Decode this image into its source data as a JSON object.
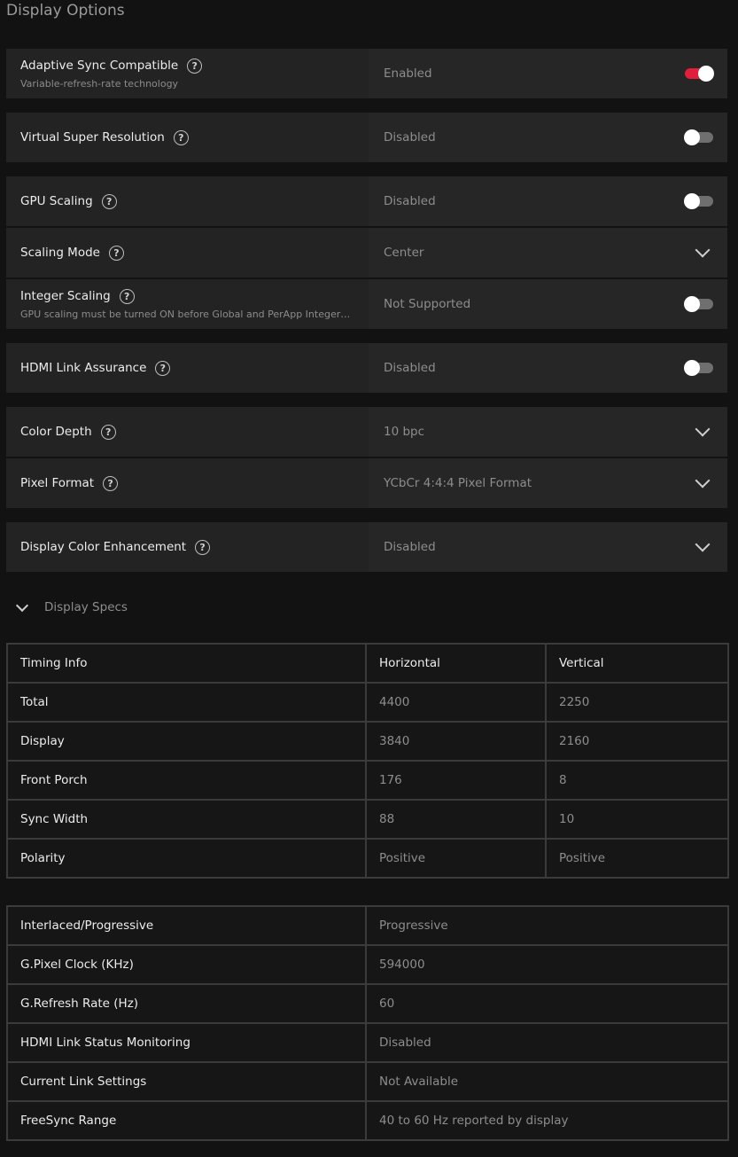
{
  "page_title": "Display Options",
  "settings": {
    "adaptive_sync": {
      "label": "Adaptive Sync Compatible",
      "sub": "Variable-refresh-rate technology",
      "value": "Enabled",
      "toggle_on": true
    },
    "vsr": {
      "label": "Virtual Super Resolution",
      "value": "Disabled",
      "toggle_on": false
    },
    "gpu_scaling": {
      "label": "GPU Scaling",
      "value": "Disabled",
      "toggle_on": false
    },
    "scaling_mode": {
      "label": "Scaling Mode",
      "value": "Center"
    },
    "integer_scaling": {
      "label": "Integer Scaling",
      "sub": "GPU scaling must be turned ON before Global and PerApp Integer Scaling",
      "value": "Not Supported",
      "toggle_on": false
    },
    "hdmi_link": {
      "label": "HDMI Link Assurance",
      "value": "Disabled",
      "toggle_on": false
    },
    "color_depth": {
      "label": "Color Depth",
      "value": "10 bpc"
    },
    "pixel_format": {
      "label": "Pixel Format",
      "value": "YCbCr 4:4:4 Pixel Format"
    },
    "color_enhancement": {
      "label": "Display Color Enhancement",
      "value": "Disabled"
    }
  },
  "help_glyph": "?",
  "display_specs": {
    "label": "Display Specs",
    "timing_table": {
      "headers": [
        "Timing Info",
        "Horizontal",
        "Vertical"
      ],
      "rows": [
        [
          "Total",
          "4400",
          "2250"
        ],
        [
          "Display",
          "3840",
          "2160"
        ],
        [
          "Front Porch",
          "176",
          "8"
        ],
        [
          "Sync Width",
          "88",
          "10"
        ],
        [
          "Polarity",
          "Positive",
          "Positive"
        ]
      ]
    },
    "info_table": {
      "rows": [
        [
          "Interlaced/Progressive",
          "Progressive"
        ],
        [
          "G.Pixel Clock (KHz)",
          "594000"
        ],
        [
          "G.Refresh Rate (Hz)",
          "60"
        ],
        [
          "HDMI Link Status Monitoring",
          "Disabled"
        ],
        [
          "Current Link Settings",
          "Not Available"
        ],
        [
          "FreeSync Range",
          "40 to 60 Hz reported by display"
        ]
      ]
    }
  },
  "colors": {
    "accent": "#e01f3c",
    "panel": "#232323",
    "background": "#121212"
  }
}
